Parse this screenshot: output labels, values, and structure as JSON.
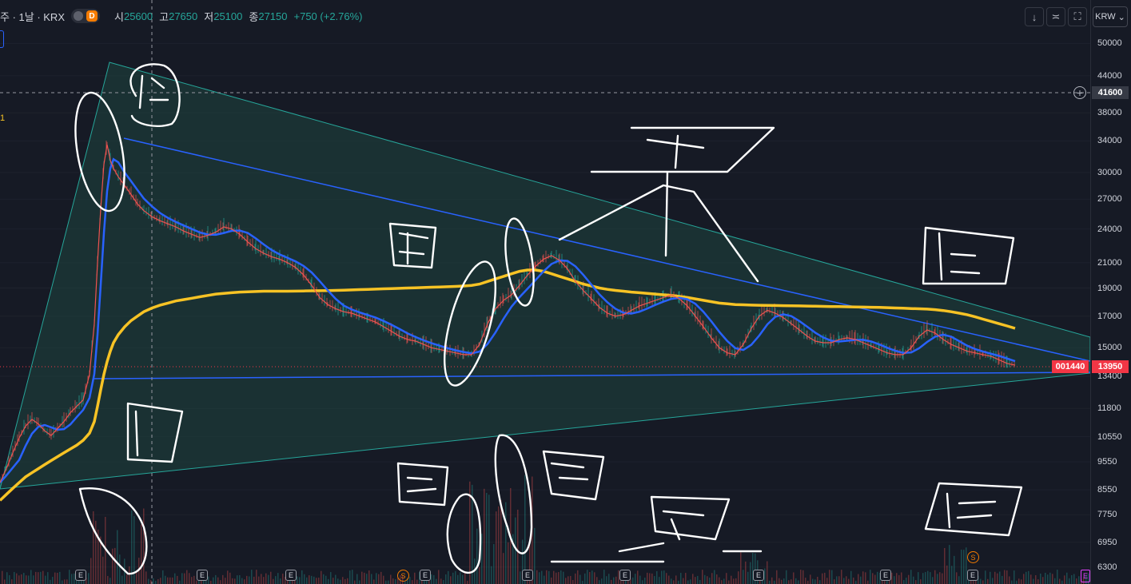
{
  "header": {
    "symbol": "주 · 1날 · KRX",
    "d_badge": "D",
    "open_label": "시",
    "open_value": "25600",
    "high_label": "고",
    "high_value": "27650",
    "low_label": "저",
    "low_value": "25100",
    "close_label": "종",
    "close_value": "27150",
    "change": "+750 (+2.76%)",
    "left_value": "1"
  },
  "toolbar": {
    "arrow_down_icon": "↓",
    "collapse_icon": "≍",
    "fullscreen_icon": "⛶",
    "currency": "KRW",
    "currency_chevron": "⌄"
  },
  "price_axis": {
    "ticks": [
      "50000",
      "44000",
      "38000",
      "34000",
      "30000",
      "27000",
      "24000",
      "21000",
      "19000",
      "17000",
      "15000",
      "13400",
      "11800",
      "10550",
      "9550",
      "8550",
      "7750",
      "6950",
      "6300"
    ],
    "crosshair_price": "41600",
    "last_price": "13950",
    "countdown": "001440",
    "plus_icon": "+"
  },
  "markers": {
    "earnings": [
      "E",
      "E",
      "E",
      "E",
      "E",
      "E",
      "E",
      "E",
      "E"
    ],
    "split_labels": [
      "S",
      "S"
    ],
    "corner_label": "E"
  },
  "colors": {
    "background": "#161a25",
    "up": "#26a69a",
    "down": "#ef5350",
    "ma_short": "#2962ff",
    "ma_long": "#f7c325",
    "triangle_fill": "#1f4d45",
    "triangle_edge": "#26a69a",
    "trendline": "#2962ff",
    "last_price": "#f23645",
    "annotation": "#ffffff"
  },
  "chart_data": {
    "type": "line",
    "title": "",
    "xlabel": "",
    "ylabel": "",
    "scale": "log",
    "ylim": [
      6000,
      54000
    ],
    "x": [
      0,
      8,
      16,
      24,
      32,
      40,
      48,
      56,
      64,
      72,
      80,
      88,
      96,
      104,
      112,
      118,
      122,
      126,
      130,
      134,
      138,
      142,
      148,
      156,
      164,
      172,
      180,
      190,
      200,
      210,
      220,
      230,
      240,
      250,
      260,
      270,
      280,
      290,
      300,
      310,
      320,
      330,
      340,
      350,
      360,
      370,
      380,
      390,
      400,
      410,
      420,
      430,
      440,
      450,
      460,
      470,
      480,
      490,
      500,
      510,
      520,
      530,
      540,
      550,
      560,
      570,
      580,
      590,
      600,
      610,
      620,
      630,
      640,
      650,
      660,
      670,
      680,
      690,
      700,
      710,
      720,
      730,
      740,
      750,
      760,
      770,
      780,
      790,
      800,
      810,
      820,
      830,
      840,
      850,
      860,
      870,
      880,
      890,
      900,
      910,
      920,
      930,
      940,
      950,
      960,
      970,
      980,
      990,
      1000,
      1010,
      1020,
      1030,
      1040,
      1050,
      1060,
      1070,
      1080,
      1090,
      1100,
      1110,
      1120,
      1130,
      1140,
      1150,
      1160,
      1170,
      1180,
      1190,
      1200,
      1210,
      1220,
      1230,
      1240,
      1250,
      1260,
      1270,
      1280,
      1290,
      1300,
      1310
    ],
    "series": [
      {
        "values": [
          8800,
          9300,
          9900,
          10500,
          11000,
          11300,
          11100,
          10800,
          10600,
          10900,
          11200,
          11600,
          11900,
          12200,
          13500,
          16500,
          21000,
          26000,
          31000,
          33500,
          31500,
          30500,
          29500,
          28500,
          27500,
          26500,
          25800,
          25200,
          24800,
          24500,
          24200,
          23800,
          23500,
          23200,
          23400,
          23700,
          24200,
          24000,
          23500,
          22800,
          22200,
          21800,
          21500,
          21300,
          21000,
          20600,
          20000,
          19200,
          18300,
          17800,
          17500,
          17300,
          17200,
          17000,
          16800,
          16600,
          16300,
          16000,
          15700,
          15500,
          15400,
          15200,
          15000,
          14900,
          14800,
          14700,
          14600,
          14600,
          15200,
          16500,
          17500,
          18100,
          18500,
          19200,
          20000,
          20700,
          21300,
          21600,
          21200,
          20500,
          19500,
          18800,
          18200,
          17600,
          17200,
          17000,
          17100,
          17400,
          17700,
          17900,
          18100,
          18300,
          18500,
          18200,
          17700,
          17000,
          16300,
          15600,
          15000,
          14700,
          14600,
          15200,
          16200,
          17000,
          17400,
          17200,
          16900,
          16500,
          16100,
          15700,
          15400,
          15300,
          15300,
          15500,
          15600,
          15500,
          15300,
          15100,
          14900,
          14700,
          14600,
          14600,
          15000,
          15700,
          16100,
          15900,
          15500,
          15200,
          15000,
          14800,
          14700,
          14600,
          14500,
          14300,
          14100,
          14000
        ]
      },
      {
        "values": [
          8200,
          8400,
          8600,
          8800,
          9000,
          9150,
          9300,
          9450,
          9600,
          9750,
          9900,
          10050,
          10200,
          10400,
          10700,
          11200,
          11900,
          12700,
          13500,
          14200,
          14800,
          15300,
          15800,
          16300,
          16700,
          17000,
          17300,
          17550,
          17750,
          17900,
          18050,
          18150,
          18250,
          18350,
          18450,
          18550,
          18600,
          18650,
          18700,
          18720,
          18740,
          18760,
          18760,
          18760,
          18760,
          18770,
          18780,
          18790,
          18800,
          18810,
          18820,
          18840,
          18860,
          18880,
          18900,
          18920,
          18940,
          18960,
          18980,
          19000,
          19020,
          19040,
          19060,
          19080,
          19100,
          19120,
          19150,
          19200,
          19300,
          19500,
          19700,
          19900,
          20100,
          20300,
          20400,
          20400,
          20300,
          20100,
          19900,
          19700,
          19500,
          19300,
          19150,
          19000,
          18900,
          18820,
          18760,
          18700,
          18650,
          18600,
          18550,
          18500,
          18450,
          18380,
          18300,
          18200,
          18100,
          18000,
          17900,
          17850,
          17800,
          17780,
          17760,
          17750,
          17740,
          17730,
          17720,
          17710,
          17700,
          17690,
          17680,
          17670,
          17660,
          17650,
          17640,
          17630,
          17620,
          17610,
          17600,
          17580,
          17560,
          17540,
          17520,
          17500,
          17480,
          17440,
          17380,
          17300,
          17200,
          17100,
          16950,
          16800,
          16650,
          16500,
          16350,
          16200
        ]
      }
    ]
  }
}
